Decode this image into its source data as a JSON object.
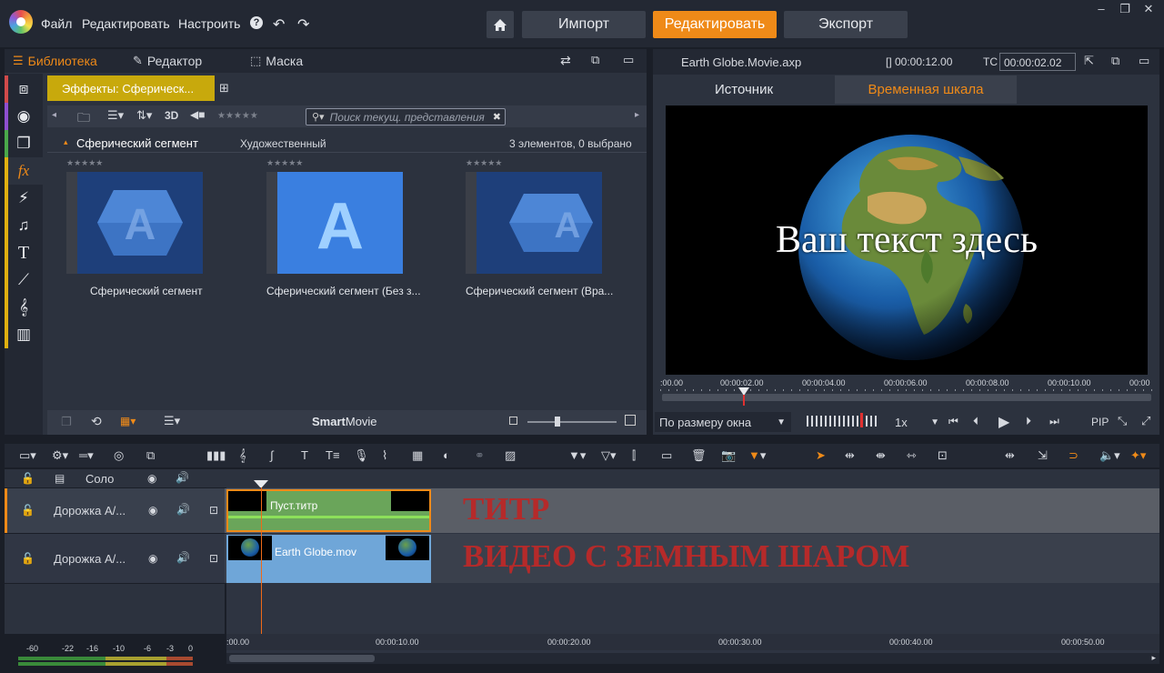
{
  "menu": {
    "file": "Файл",
    "edit": "Редактировать",
    "setup": "Настроить"
  },
  "nav": {
    "import": "Импорт",
    "edit": "Редактировать",
    "export": "Экспорт"
  },
  "library": {
    "tabs": {
      "library": "Библиотека",
      "editor": "Редактор",
      "mask": "Маска"
    },
    "effects_tab": "Эффекты: Сферическ...",
    "view_3d": "3D",
    "search_placeholder": "Поиск текущ. представления",
    "group_name": "Сферический сегмент",
    "group_category": "Художественный",
    "group_count": "3 элементов, 0 выбрано",
    "items": [
      {
        "label": "Сферический сегмент"
      },
      {
        "label": "Сферический сегмент (Без з..."
      },
      {
        "label": "Сферический сегмент (Вра..."
      }
    ],
    "smart_bold": "Smart",
    "smart_rest": "Movie"
  },
  "preview": {
    "file_name": "Earth Globe.Movie.axp",
    "duration": "[] 00:00:12.00",
    "tc_label": "TC",
    "timecode": "00:00:02.02",
    "tab_source": "Источник",
    "tab_timeline": "Временная шкала",
    "overlay_text": "Ваш текст здесь",
    "ruler_ticks": [
      ":00.00",
      "00:00:02.00",
      "00:00:04.00",
      "00:00:06.00",
      "00:00:08.00",
      "00:00:10.00",
      "00:00"
    ],
    "fit_mode": "По размеру окна",
    "speed": "1x",
    "pip": "PIP"
  },
  "timeline": {
    "solo": "Соло",
    "tracks": [
      {
        "name": "Дорожка А/...",
        "clip": "Пуст.титр",
        "overlay": "ТИТР"
      },
      {
        "name": "Дорожка А/...",
        "clip": "Earth Globe.mov",
        "overlay": "ВИДЕО С ЗЕМНЫМ ШАРОМ"
      }
    ],
    "ruler_ticks": [
      ":00.00",
      "00:00:10.00",
      "00:00:20.00",
      "00:00:30.00",
      "00:00:40.00",
      "00:00:50.00"
    ],
    "meter_ticks": [
      "-60",
      "-22",
      "-16",
      "-10",
      "-6",
      "-3",
      "0"
    ]
  },
  "colors": {
    "accent": "#ef8a18",
    "effects_tab": "#c8a90c",
    "title_clip": "#6aa55a",
    "video_clip": "#6fa6d8",
    "overlay_red": "#b52a2a"
  }
}
